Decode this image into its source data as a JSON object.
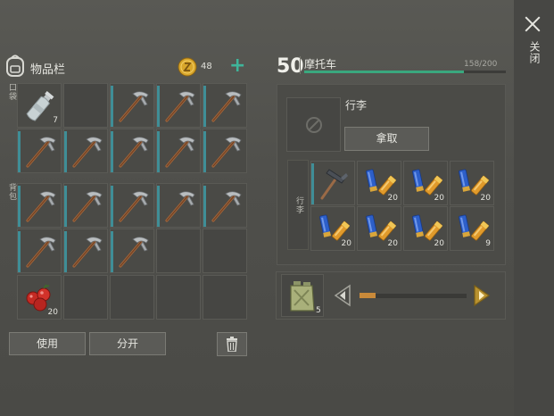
{
  "close": {
    "label": "关闭"
  },
  "inventory": {
    "title": "物品栏",
    "coins": "48",
    "add_label": "+",
    "pocket_label": "口袋",
    "backpack_label": "背包",
    "items": {
      "water_bottle": {
        "count": "7"
      },
      "berries": {
        "count": "20"
      }
    },
    "buttons": {
      "use": "使用",
      "split": "分开"
    }
  },
  "vehicle": {
    "level": "50",
    "name": "摩托车",
    "capacity": "158/200",
    "capacity_fraction": 0.79,
    "cargo_title": "行李",
    "take_label": "拿取",
    "cargo_label": "行李",
    "ammo_counts": [
      "20",
      "20",
      "20",
      "20",
      "20",
      "20",
      "20",
      "9"
    ],
    "fuel_count": "5",
    "fuel_fraction": 0.15
  },
  "colors": {
    "accent_teal": "#3f8e97",
    "capacity_green": "#3aa87e",
    "fuel_orange": "#c98a3a",
    "coin_gold": "#d8a62b"
  }
}
